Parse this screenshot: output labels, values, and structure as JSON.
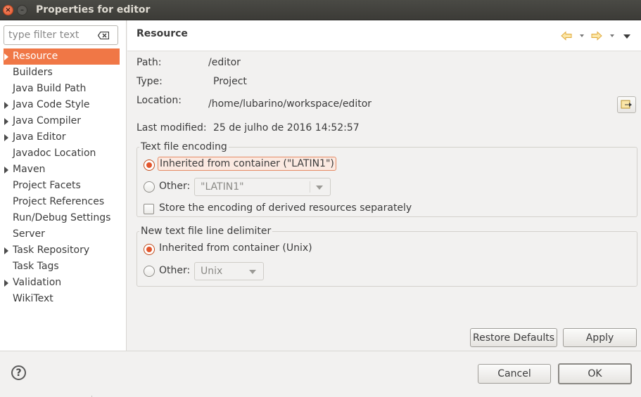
{
  "window": {
    "title": "Properties for editor"
  },
  "filter": {
    "placeholder": "type filter text"
  },
  "tree": {
    "items": [
      {
        "label": "Resource",
        "expandable": true,
        "selected": true
      },
      {
        "label": "Builders",
        "expandable": false
      },
      {
        "label": "Java Build Path",
        "expandable": false
      },
      {
        "label": "Java Code Style",
        "expandable": true
      },
      {
        "label": "Java Compiler",
        "expandable": true
      },
      {
        "label": "Java Editor",
        "expandable": true
      },
      {
        "label": "Javadoc Location",
        "expandable": false
      },
      {
        "label": "Maven",
        "expandable": true
      },
      {
        "label": "Project Facets",
        "expandable": false
      },
      {
        "label": "Project References",
        "expandable": false
      },
      {
        "label": "Run/Debug Settings",
        "expandable": false
      },
      {
        "label": "Server",
        "expandable": false
      },
      {
        "label": "Task Repository",
        "expandable": true
      },
      {
        "label": "Task Tags",
        "expandable": false
      },
      {
        "label": "Validation",
        "expandable": true
      },
      {
        "label": "WikiText",
        "expandable": false
      }
    ]
  },
  "page": {
    "title": "Resource",
    "path_label": "Path:",
    "path_value": "/editor",
    "type_label": "Type:",
    "type_value": "Project",
    "location_label": "Location:",
    "location_value": "/home/lubarino/workspace/editor",
    "modified_label": "Last modified:",
    "modified_value": "25 de julho de 2016 14:52:57"
  },
  "encoding": {
    "legend": "Text file encoding",
    "inherited_label": "Inherited from container (\"LATIN1\")",
    "other_label": "Other:",
    "other_value": "\"LATIN1\"",
    "derived_label": "Store the encoding of derived resources separately",
    "inherited_checked": true,
    "derived_checked": false
  },
  "delimiter": {
    "legend": "New text file line delimiter",
    "inherited_label": "Inherited from container (Unix)",
    "other_label": "Other:",
    "other_value": "Unix",
    "inherited_checked": true
  },
  "buttons": {
    "restore_defaults": "Restore Defaults",
    "apply": "Apply",
    "cancel": "Cancel",
    "ok": "OK",
    "help": "?"
  },
  "colors": {
    "accent": "#f07746",
    "titlebar": "#3c3b37",
    "radio_checked": "#e2552c"
  }
}
